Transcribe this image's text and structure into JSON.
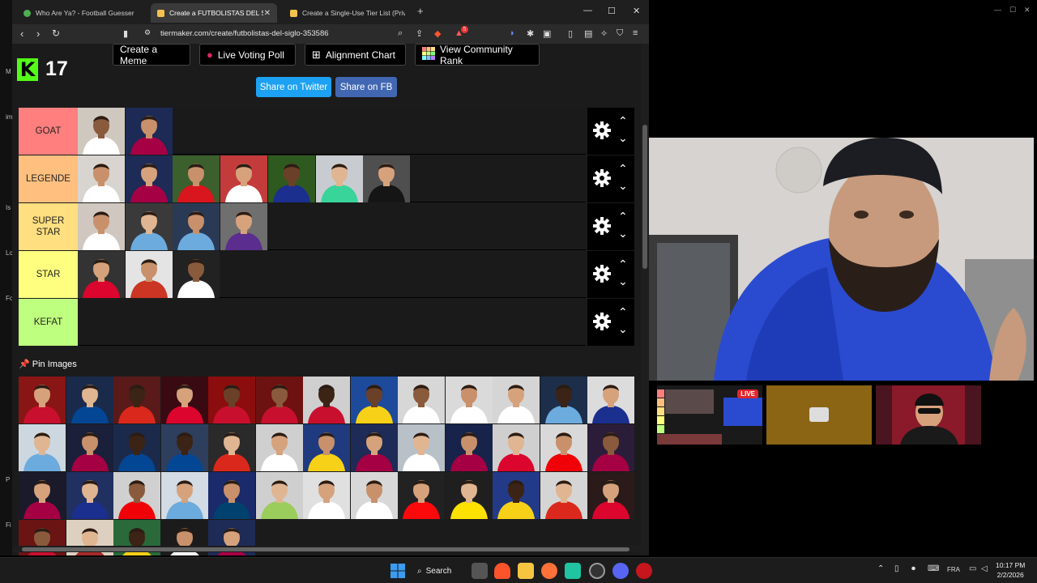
{
  "browser": {
    "tabs": [
      {
        "title": "Who Are Ya? - Football Guesser",
        "active": false,
        "favicon_color": "#4caf50"
      },
      {
        "title": "Create a FUTBOLISTAS DEL SIGLO",
        "active": true,
        "favicon_color": "#f2c14e"
      },
      {
        "title": "Create a Single-Use Tier List (Private",
        "active": false,
        "favicon_color": "#f2c14e"
      }
    ],
    "url": "tiermaker.com/create/futbolistas-del-siglo-353586",
    "shield_badge": "5"
  },
  "stream": {
    "platform_icon": "kick-logo",
    "viewer_count": "17"
  },
  "toolbar": {
    "create_meme": "Create a Meme",
    "live_voting": "Live Voting Poll",
    "alignment_chart": "Alignment Chart",
    "community_rank": "View Community Rank",
    "share_twitter": "Share on Twitter",
    "share_fb": "Share on FB"
  },
  "tiers": [
    {
      "label": "GOAT",
      "color": "#ff7f7f",
      "items": [
        {
          "bg": "#cfc8bf",
          "shirt": "#ffffff",
          "skin": "#8a5a3c"
        },
        {
          "bg": "#1c2a55",
          "shirt": "#a50044",
          "skin": "#c8916b"
        }
      ]
    },
    {
      "label": "LEGENDE",
      "color": "#ffbf7f",
      "items": [
        {
          "bg": "#d8d4cf",
          "shirt": "#ffffff",
          "skin": "#c8916b"
        },
        {
          "bg": "#1d2b56",
          "shirt": "#a50044",
          "skin": "#d6a27c"
        },
        {
          "bg": "#3b5f2d",
          "shirt": "#d9151e",
          "skin": "#c8916b"
        },
        {
          "bg": "#c43b3b",
          "shirt": "#ffffff",
          "skin": "#d6a27c"
        },
        {
          "bg": "#2f5a1f",
          "shirt": "#1b2f8f",
          "skin": "#6b4028"
        },
        {
          "bg": "#c8ccd0",
          "shirt": "#38d49a",
          "skin": "#e0b592"
        },
        {
          "bg": "#4f4f4f",
          "shirt": "#151515",
          "skin": "#d6a27c"
        }
      ]
    },
    {
      "label": "SUPER STAR",
      "color": "#ffdf7f",
      "items": [
        {
          "bg": "#d0c8c0",
          "shirt": "#ffffff",
          "skin": "#c8916b"
        },
        {
          "bg": "#3a3a3a",
          "shirt": "#6cabdd",
          "skin": "#e0b592"
        },
        {
          "bg": "#2a3a55",
          "shirt": "#6cabdd",
          "skin": "#c8916b"
        },
        {
          "bg": "#6f6f6f",
          "shirt": "#5b2d8e",
          "skin": "#d6a27c"
        }
      ]
    },
    {
      "label": "STAR",
      "color": "#ffff7f",
      "items": [
        {
          "bg": "#333333",
          "shirt": "#dc052d",
          "skin": "#d6a27c"
        },
        {
          "bg": "#e4e4e4",
          "shirt": "#cb3524",
          "skin": "#c8916b"
        },
        {
          "bg": "#222222",
          "shirt": "#ffffff",
          "skin": "#8a5a3c"
        }
      ]
    },
    {
      "label": "KEFAT",
      "color": "#bfff7f",
      "items": []
    }
  ],
  "pin_images": {
    "label": "Pin Images",
    "rows": [
      [
        {
          "bg": "#8a1515",
          "shirt": "#c8102e",
          "skin": "#d6a27c"
        },
        {
          "bg": "#1a2a4a",
          "shirt": "#034694",
          "skin": "#e0b592"
        },
        {
          "bg": "#5a1a1a",
          "shirt": "#da291c",
          "skin": "#3b2415"
        },
        {
          "bg": "#3a0a12",
          "shirt": "#dc052d",
          "skin": "#d6a27c"
        },
        {
          "bg": "#8b0d0d",
          "shirt": "#c8102e",
          "skin": "#6b4028"
        },
        {
          "bg": "#6e1111",
          "shirt": "#c8102e",
          "skin": "#8a5a3c"
        },
        {
          "bg": "#cfcfcf",
          "shirt": "#c8102e",
          "skin": "#3b2415"
        },
        {
          "bg": "#1d4a9a",
          "shirt": "#f7d117",
          "skin": "#6b4028"
        },
        {
          "bg": "#d7d7d7",
          "shirt": "#ffffff",
          "skin": "#8a5a3c"
        },
        {
          "bg": "#dadada",
          "shirt": "#ffffff",
          "skin": "#c8916b"
        },
        {
          "bg": "#d5d5d5",
          "shirt": "#ffffff",
          "skin": "#d6a27c"
        },
        {
          "bg": "#1c2e4a",
          "shirt": "#6cabdd",
          "skin": "#3b2415"
        },
        {
          "bg": "#dcdcdc",
          "shirt": "#1b2f8f",
          "skin": "#d6a27c"
        }
      ],
      [
        {
          "bg": "#cdd7e0",
          "shirt": "#6cabdd",
          "skin": "#e0b592"
        },
        {
          "bg": "#1a1f3a",
          "shirt": "#a50044",
          "skin": "#c8916b"
        },
        {
          "bg": "#1b2a4b",
          "shirt": "#034694",
          "skin": "#3b2415"
        },
        {
          "bg": "#2e3f5e",
          "shirt": "#034694",
          "skin": "#3b2415"
        },
        {
          "bg": "#2a2a2a",
          "shirt": "#da291c",
          "skin": "#e0b592"
        },
        {
          "bg": "#cfcfcf",
          "shirt": "#ffffff",
          "skin": "#d6a27c"
        },
        {
          "bg": "#203a80",
          "shirt": "#f7d117",
          "skin": "#c8916b"
        },
        {
          "bg": "#1d2b56",
          "shirt": "#a50044",
          "skin": "#d6a27c"
        },
        {
          "bg": "#b8c0c8",
          "shirt": "#ffffff",
          "skin": "#e0b592"
        },
        {
          "bg": "#17234a",
          "shirt": "#a50044",
          "skin": "#c8916b"
        },
        {
          "bg": "#cfcfcf",
          "shirt": "#dc052d",
          "skin": "#e0b592"
        },
        {
          "bg": "#d9d9d9",
          "shirt": "#ef0107",
          "skin": "#c8916b"
        },
        {
          "bg": "#2b1d3a",
          "shirt": "#a50044",
          "skin": "#8a5a3c"
        }
      ],
      [
        {
          "bg": "#1a1a2a",
          "shirt": "#a50044",
          "skin": "#d6a27c"
        },
        {
          "bg": "#203060",
          "shirt": "#1b2f8f",
          "skin": "#e0b592"
        },
        {
          "bg": "#d0d0d0",
          "shirt": "#ef0107",
          "skin": "#8a5a3c"
        },
        {
          "bg": "#d3dbe4",
          "shirt": "#6cabdd",
          "skin": "#d6a27c"
        },
        {
          "bg": "#1a2a6a",
          "shirt": "#004170",
          "skin": "#c8916b"
        },
        {
          "bg": "#cfcfcf",
          "shirt": "#9acd5c",
          "skin": "#e0b592"
        },
        {
          "bg": "#e0e0e0",
          "shirt": "#ffffff",
          "skin": "#d6a27c"
        },
        {
          "bg": "#d8d8d8",
          "shirt": "#ffffff",
          "skin": "#c8916b"
        },
        {
          "bg": "#222222",
          "shirt": "#fb090b",
          "skin": "#d6a27c"
        },
        {
          "bg": "#1f1f1f",
          "shirt": "#fde100",
          "skin": "#e0b592"
        },
        {
          "bg": "#223a88",
          "shirt": "#f7d117",
          "skin": "#3b2415"
        },
        {
          "bg": "#d5d5d5",
          "shirt": "#da291c",
          "skin": "#e0b592"
        },
        {
          "bg": "#2a1a1a",
          "shirt": "#dc052d",
          "skin": "#d6a27c"
        }
      ],
      [
        {
          "bg": "#6a1414",
          "shirt": "#c8102e",
          "skin": "#8a5a3c"
        },
        {
          "bg": "#ddd0c0",
          "shirt": "#a52a2a",
          "skin": "#e0b592"
        },
        {
          "bg": "#2a6a3a",
          "shirt": "#f7d117",
          "skin": "#3b2415"
        },
        {
          "bg": "#1b1b1b",
          "shirt": "#ffffff",
          "skin": "#c8916b"
        },
        {
          "bg": "#1d2b56",
          "shirt": "#a50044",
          "skin": "#d6a27c"
        }
      ]
    ]
  },
  "overlay": {
    "live_badge": "LIVE"
  },
  "taskbar": {
    "search_label": "Search",
    "language": "FRA",
    "time": "10:17 PM",
    "date": "2/2/2026"
  }
}
